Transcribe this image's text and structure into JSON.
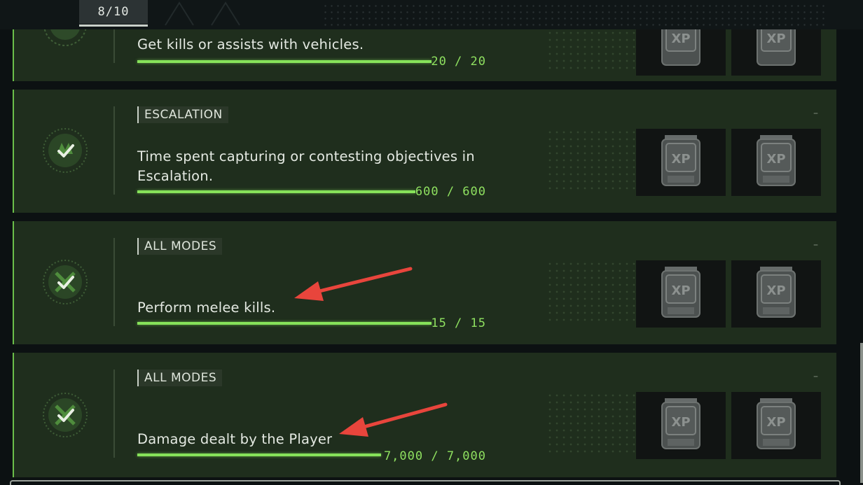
{
  "header": {
    "counter": "8/10"
  },
  "challenges": [
    {
      "mode": "",
      "description": "Get kills or assists with vehicles.",
      "progress": "20 / 20",
      "progress_fraction": 1.0,
      "completed": true
    },
    {
      "mode": "ESCALATION",
      "description": "Time spent capturing or contesting objectives in Escalation.",
      "progress": "600 / 600",
      "progress_fraction": 1.0,
      "completed": true
    },
    {
      "mode": "ALL MODES",
      "description": "Perform melee kills.",
      "progress": "15 / 15",
      "progress_fraction": 1.0,
      "completed": true
    },
    {
      "mode": "ALL MODES",
      "description": "Damage dealt by the Player",
      "progress": "7,000 / 7,000",
      "progress_fraction": 1.0,
      "completed": true
    }
  ],
  "collapse_symbol": "–",
  "reward_label": "XP",
  "icons": {
    "medal": "check-medal-icon",
    "reward": "xp-token-icon"
  },
  "colors": {
    "accent": "#86e25a",
    "card_bg": "#1f2e1d",
    "annotation_arrow": "#e8453c"
  }
}
